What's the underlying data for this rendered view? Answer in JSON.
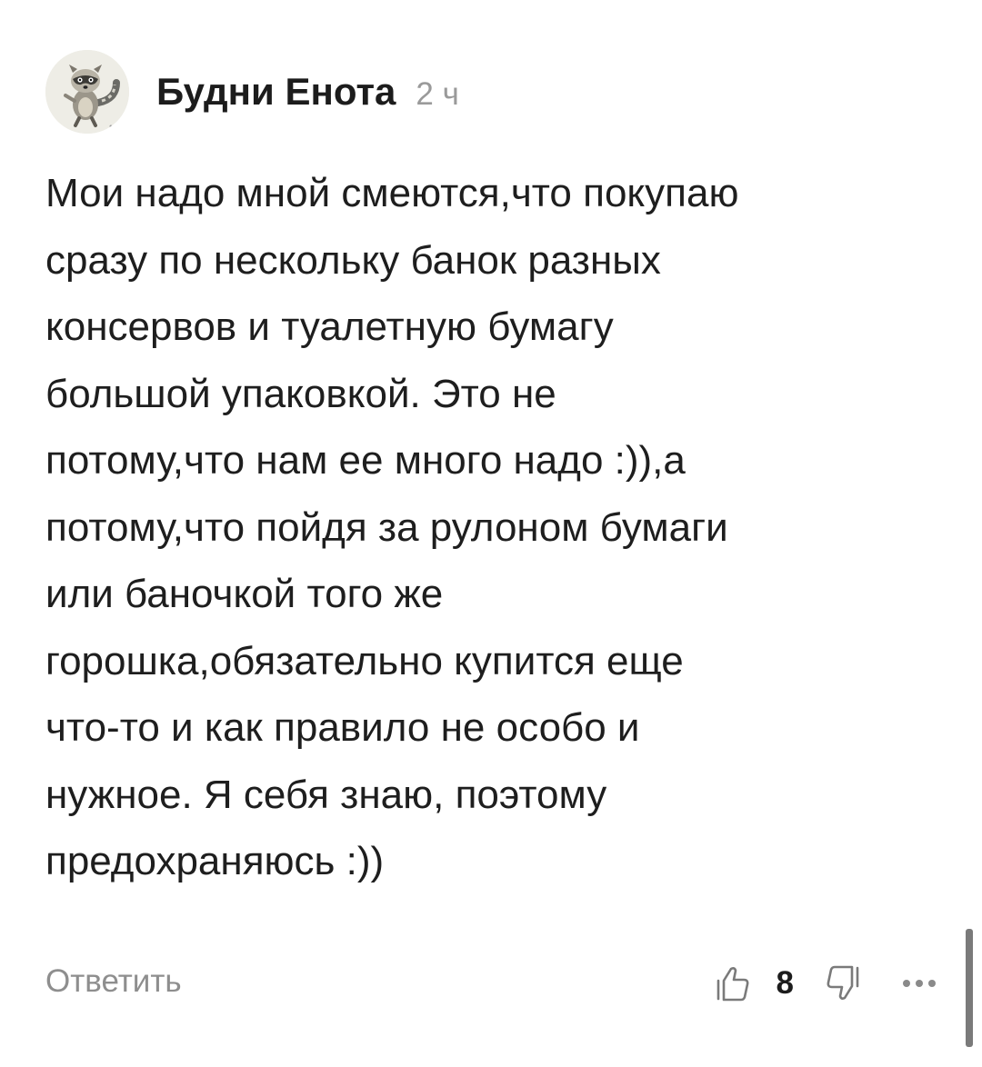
{
  "comment": {
    "author": "Будни Енота",
    "time": "2 ч",
    "text": "Мои надо мной смеются,что покупаю\nсразу по нескольку банок разных\nконсервов и туалетную бумагу\nбольшой упаковкой. Это не\nпотому,что нам ее много надо :)),а\nпотому,что пойдя за рулоном бумаги\nили баночкой того же\nгорошка,обязательно купится еще\nчто-то и как правило не особо и\nнужное. Я себя знаю, поэтому\nпредохраняюсь :))",
    "avatar_icon": "raccoon-avatar"
  },
  "footer": {
    "reply_label": "Ответить",
    "like_count": "8",
    "like_icon": "thumbs-up-icon",
    "dislike_icon": "thumbs-down-icon",
    "more_icon": "more-dots-icon"
  },
  "colors": {
    "text": "#1e1e1e",
    "muted": "#8e8e8e",
    "background": "#ffffff"
  }
}
